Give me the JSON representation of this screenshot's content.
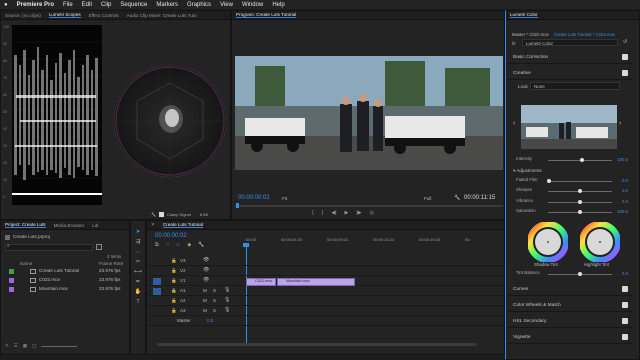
{
  "menubar": {
    "apple": "",
    "app": "Premiere Pro",
    "items": [
      "File",
      "Edit",
      "Clip",
      "Sequence",
      "Markers",
      "Graphics",
      "View",
      "Window",
      "Help"
    ]
  },
  "source_panel": {
    "tabs": [
      "Source: (no clips)",
      "Lumetri Scopes",
      "Effect Controls",
      "Audio Clip Mixer: Create Luts Tuto"
    ],
    "scale_left": [
      "100",
      "90",
      "80",
      "70",
      "60",
      "50",
      "40",
      "30",
      "20",
      "10",
      "0"
    ],
    "clamp_label": "Clamp Signal",
    "bit_label": "8 Bit"
  },
  "program_panel": {
    "tab": "Program: Create Luts Tutorial",
    "timecode": "00:00:00:02",
    "fit": "Fit",
    "quality": "Full",
    "duration": "00:00:11:15"
  },
  "project_panel": {
    "tabs": [
      "Project: Create Luts",
      "Media Browser",
      "Lib"
    ],
    "file": "Create Luts.prproj",
    "count": "3 Items",
    "col_name": "Name",
    "col_rate": "Frame Rate",
    "items": [
      {
        "name": "Create Luts Tutorial",
        "rate": "23.976 fps",
        "color": "#3fa23f"
      },
      {
        "name": "C022.mov",
        "rate": "23.976 fps",
        "color": "#9a6ad6"
      },
      {
        "name": "Mountain.mov",
        "rate": "23.976 fps",
        "color": "#9a6ad6"
      }
    ]
  },
  "timeline": {
    "tab": "Create Luts Tutorial",
    "timecode": "00:00:00:02",
    "ruler": [
      ":00:00",
      "00:00:04:23",
      "00:00:09:23",
      "00:00:14:23",
      "00:00:19:23",
      "00:"
    ],
    "tracks": [
      "V3",
      "V2",
      "V1",
      "A1",
      "A2",
      "A3"
    ],
    "master_label": "Master",
    "master_value": "0.0",
    "clips": [
      {
        "name": "C022.mov",
        "color": "#b9a4e6"
      },
      {
        "name": "Mountain.mov",
        "color": "#b9a4e6"
      }
    ]
  },
  "lumetri": {
    "title": "Lumetri Color",
    "master": "Master * C022.mov",
    "sequence": "Create Luts Tutorial * C022.mov",
    "fx_label": "fx",
    "effect": "Lumetri Color",
    "sections": {
      "basic": "Basic Correction",
      "creative": "Creative",
      "curves": "Curves",
      "wheels": "Color Wheels & Match",
      "hsl": "HSL Secondary",
      "vignette": "Vignette"
    },
    "look_label": "Look",
    "look_value": "None",
    "intensity_label": "Intensity",
    "intensity_value": "100.0",
    "adjustments_label": "Adjustments",
    "adjustments": [
      {
        "label": "Faded Film",
        "value": "0.0",
        "pos": 0.0
      },
      {
        "label": "Sharpen",
        "value": "0.0",
        "pos": 0.5
      },
      {
        "label": "Vibrance",
        "value": "0.0",
        "pos": 0.5
      },
      {
        "label": "Saturation",
        "value": "100.0",
        "pos": 0.5
      }
    ],
    "shadow_tint": "Shadow Tint",
    "highlight_tint": "Highlight Tint",
    "tint_balance_label": "Tint Balance",
    "tint_balance_value": "0.0"
  }
}
